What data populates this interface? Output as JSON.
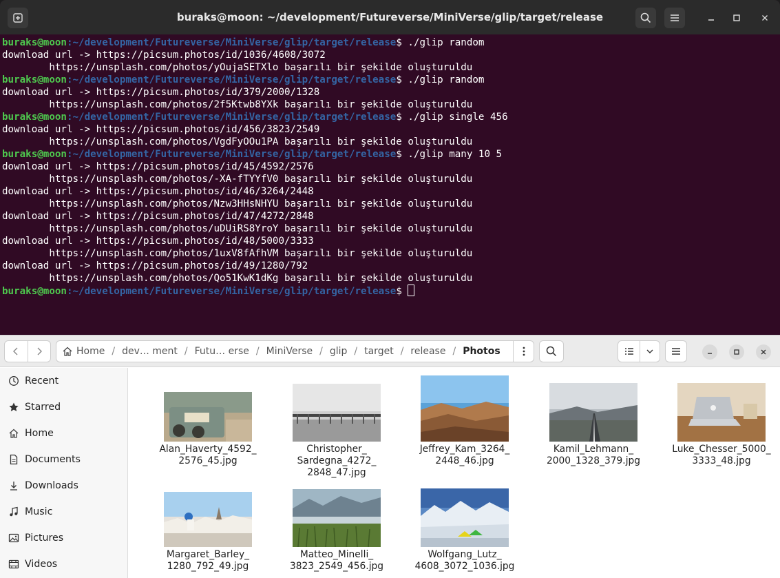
{
  "terminal": {
    "title": "buraks@moon: ~/development/Futureverse/MiniVerse/glip/target/release",
    "prompt_user": "buraks@moon",
    "prompt_path": ":~/development/Futureverse/MiniVerse/glip/target/release",
    "lines": [
      {
        "type": "prompt",
        "cmd": " ./glip random"
      },
      {
        "type": "out",
        "text": "download url -> https://picsum.photos/id/1036/4608/3072"
      },
      {
        "type": "out",
        "text": "        https://unsplash.com/photos/yOujaSETXlo başarılı bir şekilde oluşturuldu"
      },
      {
        "type": "prompt",
        "cmd": " ./glip random"
      },
      {
        "type": "out",
        "text": "download url -> https://picsum.photos/id/379/2000/1328"
      },
      {
        "type": "out",
        "text": "        https://unsplash.com/photos/2f5Ktwb8YXk başarılı bir şekilde oluşturuldu"
      },
      {
        "type": "prompt",
        "cmd": " ./glip single 456"
      },
      {
        "type": "out",
        "text": "download url -> https://picsum.photos/id/456/3823/2549"
      },
      {
        "type": "out",
        "text": "        https://unsplash.com/photos/VgdFyOOu1PA başarılı bir şekilde oluşturuldu"
      },
      {
        "type": "prompt",
        "cmd": " ./glip many 10 5"
      },
      {
        "type": "out",
        "text": "download url -> https://picsum.photos/id/45/4592/2576"
      },
      {
        "type": "out",
        "text": "        https://unsplash.com/photos/-XA-fTYYfV0 başarılı bir şekilde oluşturuldu"
      },
      {
        "type": "out",
        "text": "download url -> https://picsum.photos/id/46/3264/2448"
      },
      {
        "type": "out",
        "text": "        https://unsplash.com/photos/Nzw3HHsNHYU başarılı bir şekilde oluşturuldu"
      },
      {
        "type": "out",
        "text": "download url -> https://picsum.photos/id/47/4272/2848"
      },
      {
        "type": "out",
        "text": "        https://unsplash.com/photos/uDUiRS8YroY başarılı bir şekilde oluşturuldu"
      },
      {
        "type": "out",
        "text": "download url -> https://picsum.photos/id/48/5000/3333"
      },
      {
        "type": "out",
        "text": "        https://unsplash.com/photos/1uxV8fAfhVM başarılı bir şekilde oluşturuldu"
      },
      {
        "type": "out",
        "text": "download url -> https://picsum.photos/id/49/1280/792"
      },
      {
        "type": "out",
        "text": "        https://unsplash.com/photos/Qo51KwK1dKg başarılı bir şekilde oluşturuldu"
      },
      {
        "type": "prompt",
        "cmd": " ",
        "cursor": true
      }
    ]
  },
  "files": {
    "path": [
      {
        "label": "Home",
        "icon": "home-icon"
      },
      {
        "label": "dev… ment"
      },
      {
        "label": "Futu… erse"
      },
      {
        "label": "MiniVerse"
      },
      {
        "label": "glip"
      },
      {
        "label": "target"
      },
      {
        "label": "release"
      },
      {
        "label": "Photos",
        "current": true
      }
    ],
    "sidebar": [
      {
        "label": "Recent",
        "icon": "clock-icon"
      },
      {
        "label": "Starred",
        "icon": "star-icon"
      },
      {
        "label": "Home",
        "icon": "home-icon"
      },
      {
        "label": "Documents",
        "icon": "document-icon"
      },
      {
        "label": "Downloads",
        "icon": "download-icon"
      },
      {
        "label": "Music",
        "icon": "music-icon"
      },
      {
        "label": "Pictures",
        "icon": "pictures-icon"
      },
      {
        "label": "Videos",
        "icon": "video-icon"
      }
    ],
    "photos": [
      {
        "name": "Alan_Haverty_4592_\n2576_45.jpg"
      },
      {
        "name": "Christopher_\nSardegna_4272_\n2848_47.jpg"
      },
      {
        "name": "Jeffrey_Kam_3264_\n2448_46.jpg"
      },
      {
        "name": "Kamil_Lehmann_\n2000_1328_379.jpg"
      },
      {
        "name": "Luke_Chesser_5000_\n3333_48.jpg"
      },
      {
        "name": "Margaret_Barley_\n1280_792_49.jpg"
      },
      {
        "name": "Matteo_Minelli_\n3823_2549_456.jpg"
      },
      {
        "name": "Wolfgang_Lutz_\n4608_3072_1036.jpg"
      }
    ]
  }
}
